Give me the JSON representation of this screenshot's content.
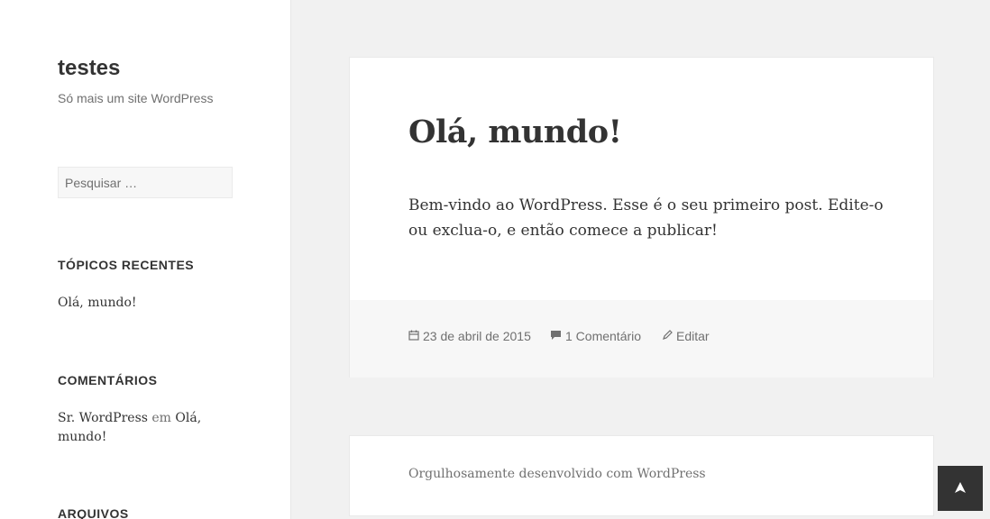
{
  "site": {
    "title": "testes",
    "description": "Só mais um site WordPress"
  },
  "search": {
    "placeholder": "Pesquisar …"
  },
  "widgets": {
    "recent": {
      "title": "TÓPICOS RECENTES",
      "items": [
        "Olá, mundo!"
      ]
    },
    "comments": {
      "title": "COMENTÁRIOS",
      "author": "Sr. WordPress",
      "connector": "em",
      "post": "Olá, mundo!"
    },
    "archives": {
      "title": "ARQUIVOS"
    }
  },
  "post": {
    "title": "Olá, mundo!",
    "content": "Bem-vindo ao WordPress. Esse é o seu primeiro post. Edite-o ou exclua-o, e então comece a publicar!",
    "meta": {
      "date": "23 de abril de 2015",
      "comments": "1 Comentário",
      "edit": "Editar"
    }
  },
  "footer": {
    "credit": "Orgulhosamente desenvolvido com WordPress"
  },
  "icons": {
    "date": "calendar-icon",
    "comments": "comment-icon",
    "edit": "pencil-icon",
    "back_to_top": "arrow-up-icon"
  }
}
